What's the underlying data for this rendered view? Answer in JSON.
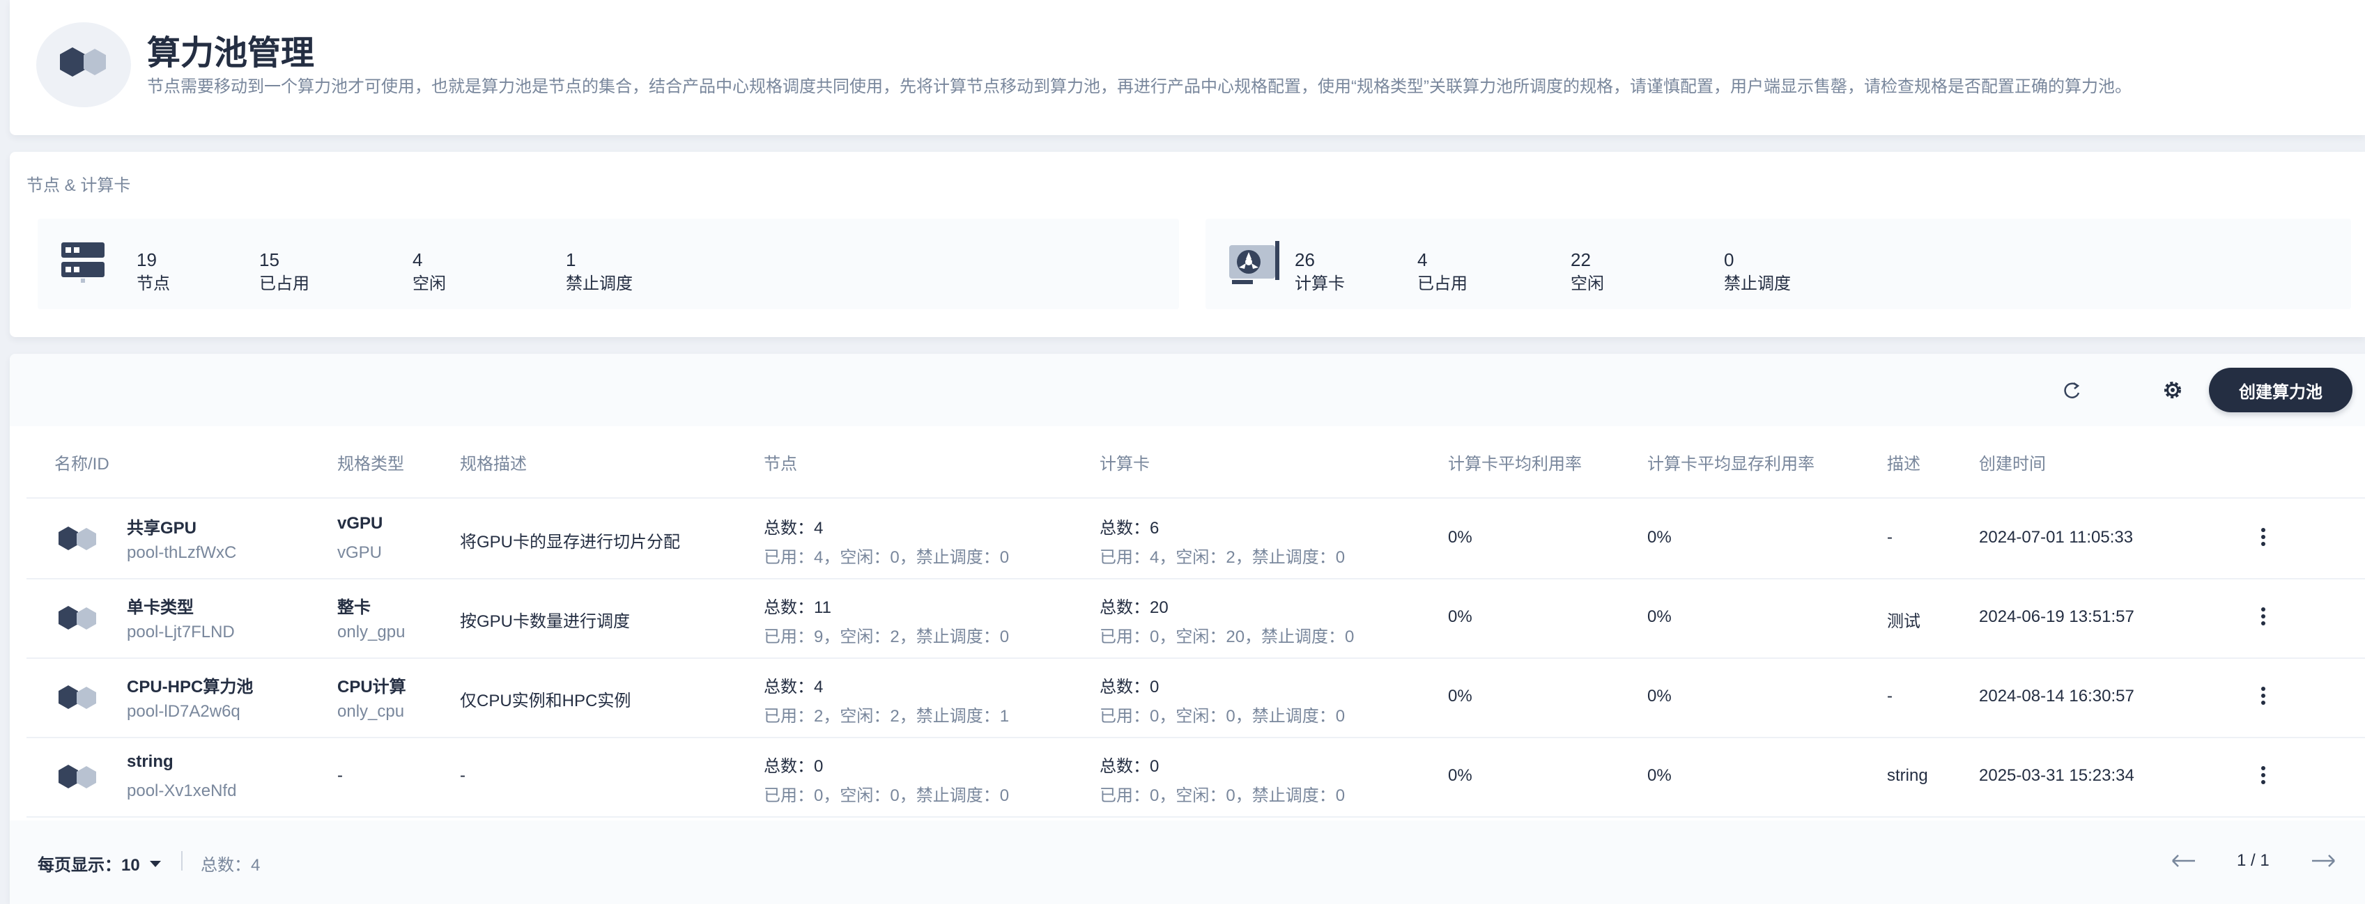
{
  "header": {
    "title": "算力池管理",
    "description": "节点需要移动到一个算力池才可使用，也就是算力池是节点的集合，结合产品中心规格调度共同使用，先将计算节点移动到算力池，再进行产品中心规格配置，使用“规格类型”关联算力池所调度的规格，请谨慎配置，用户端显示售罄，请检查规格是否配置正确的算力池。"
  },
  "stats": {
    "title": "节点 & 计算卡",
    "nodes": [
      {
        "value": "19",
        "label": "节点"
      },
      {
        "value": "15",
        "label": "已占用"
      },
      {
        "value": "4",
        "label": "空闲"
      },
      {
        "value": "1",
        "label": "禁止调度"
      }
    ],
    "cards": [
      {
        "value": "26",
        "label": "计算卡"
      },
      {
        "value": "4",
        "label": "已占用"
      },
      {
        "value": "22",
        "label": "空闲"
      },
      {
        "value": "0",
        "label": "禁止调度"
      }
    ]
  },
  "toolbar": {
    "create_label": "创建算力池",
    "icons": [
      "refresh-icon",
      "gear-icon"
    ]
  },
  "table": {
    "headers": [
      "名称/ID",
      "规格类型",
      "规格描述",
      "节点",
      "计算卡",
      "计算卡平均利用率",
      "计算卡平均显存利用率",
      "描述",
      "创建时间"
    ],
    "rows": [
      {
        "name": "共享GPU",
        "id": "pool-thLzfWxC",
        "spec_type": "vGPU",
        "spec_code": "vGPU",
        "spec_desc": "将GPU卡的显存进行切片分配",
        "nodes_total": "总数：4",
        "nodes_detail": "已用：4，空闲：0，禁止调度：0",
        "cards_total": "总数：6",
        "cards_detail": "已用：4，空闲：2，禁止调度：0",
        "util": "0%",
        "mem_util": "0%",
        "desc": "-",
        "created": "2024-07-01 11:05:33"
      },
      {
        "name": "单卡类型",
        "id": "pool-Ljt7FLND",
        "spec_type": "整卡",
        "spec_code": "only_gpu",
        "spec_desc": "按GPU卡数量进行调度",
        "nodes_total": "总数：11",
        "nodes_detail": "已用：9，空闲：2，禁止调度：0",
        "cards_total": "总数：20",
        "cards_detail": "已用：0，空闲：20，禁止调度：0",
        "util": "0%",
        "mem_util": "0%",
        "desc": "测试",
        "created": "2024-06-19 13:51:57"
      },
      {
        "name": "CPU-HPC算力池",
        "id": "pool-lD7A2w6q",
        "spec_type": "CPU计算",
        "spec_code": "only_cpu",
        "spec_desc": "仅CPU实例和HPC实例",
        "nodes_total": "总数：4",
        "nodes_detail": "已用：2，空闲：2，禁止调度：1",
        "cards_total": "总数：0",
        "cards_detail": "已用：0，空闲：0，禁止调度：0",
        "util": "0%",
        "mem_util": "0%",
        "desc": "-",
        "created": "2024-08-14 16:30:57"
      },
      {
        "name": "string",
        "id": "pool-Xv1xeNfd",
        "spec_type": "-",
        "spec_code": "",
        "spec_desc": "-",
        "nodes_total": "总数：0",
        "nodes_detail": "已用：0，空闲：0，禁止调度：0",
        "cards_total": "总数：0",
        "cards_detail": "已用：0，空闲：0，禁止调度：0",
        "util": "0%",
        "mem_util": "0%",
        "desc": "string",
        "created": "2025-03-31 15:23:34"
      }
    ]
  },
  "pagination": {
    "page_size_label": "每页显示：10",
    "total_label": "总数：4",
    "page_label": "1 / 1"
  },
  "colors": {
    "primary": "#242e42",
    "secondary_text": "#79879c",
    "background": "#eef1f6"
  }
}
